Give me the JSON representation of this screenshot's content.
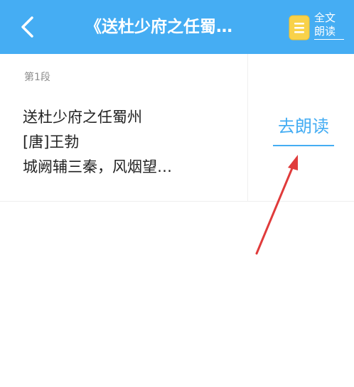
{
  "header": {
    "title": "《送杜少府之任蜀…",
    "read_all_label_line1": "全文",
    "read_all_label_line2": "朗读",
    "background_color": "#45adf3",
    "back_icon": "chevron-left-icon",
    "read_all_icon": "document-icon"
  },
  "card": {
    "paragraph_label": "第1段",
    "lines": [
      "送杜少府之任蜀州",
      "[唐]王勃",
      "城阙辅三秦，风烟望…"
    ],
    "action_label": "去朗读",
    "accent_color": "#45adf3"
  },
  "annotation": {
    "arrow_color": "#e03b3b"
  }
}
